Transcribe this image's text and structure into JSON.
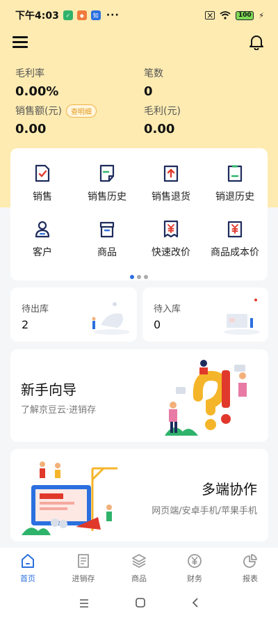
{
  "status": {
    "time": "下午4:03",
    "dots": "···",
    "battery": "100"
  },
  "stats": [
    {
      "label": "毛利率",
      "value": "0.00%"
    },
    {
      "label": "笔数",
      "value": "0"
    },
    {
      "label": "销售额(元)",
      "value": "0.00",
      "badge": "查明细"
    },
    {
      "label": "毛利(元)",
      "value": "0.00"
    }
  ],
  "grid": [
    {
      "label": "销售",
      "icon": "sales-doc-icon"
    },
    {
      "label": "销售历史",
      "icon": "sales-history-icon"
    },
    {
      "label": "销售退货",
      "icon": "sales-return-icon"
    },
    {
      "label": "销退历史",
      "icon": "return-history-icon"
    },
    {
      "label": "客户",
      "icon": "customer-icon"
    },
    {
      "label": "商品",
      "icon": "product-box-icon"
    },
    {
      "label": "快速改价",
      "icon": "quick-price-icon"
    },
    {
      "label": "商品成本价",
      "icon": "cost-price-icon"
    }
  ],
  "stock": [
    {
      "label": "待出库",
      "value": "2"
    },
    {
      "label": "待入库",
      "value": "0"
    }
  ],
  "promo1": {
    "title": "新手向导",
    "subtitle": "了解京豆云·进销存"
  },
  "promo2": {
    "title": "多端协作",
    "subtitle": "网页端/安卓手机/苹果手机"
  },
  "tabs": [
    {
      "label": "首页",
      "icon": "home-icon"
    },
    {
      "label": "进销存",
      "icon": "document-icon"
    },
    {
      "label": "商品",
      "icon": "layers-icon"
    },
    {
      "label": "财务",
      "icon": "yuan-icon"
    },
    {
      "label": "报表",
      "icon": "pie-chart-icon"
    }
  ],
  "colors": {
    "accent": "#2b6fe0",
    "header_bg": "#fdebb1",
    "icon_red": "#e0392b",
    "icon_navy": "#1d2b5c",
    "icon_green": "#2fb36b"
  }
}
